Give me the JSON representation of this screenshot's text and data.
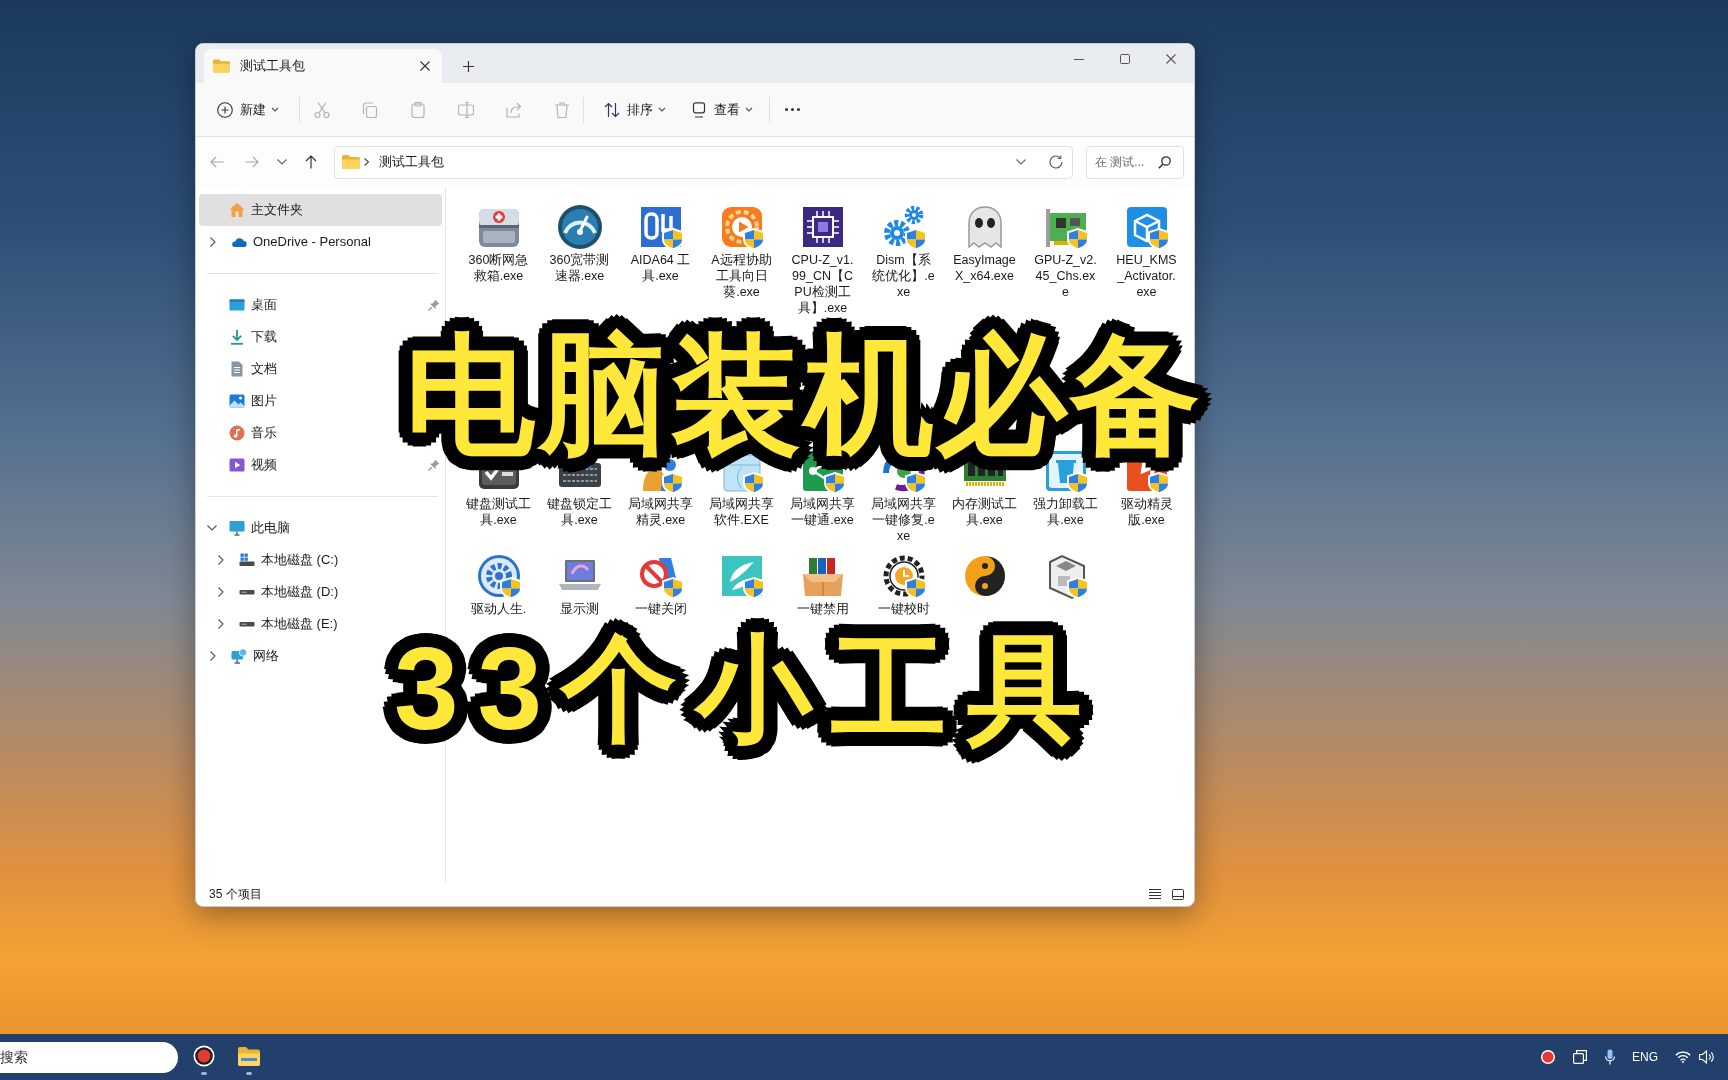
{
  "tabs": [
    {
      "title": "测试工具包",
      "selected": true
    }
  ],
  "toolbar": {
    "new_button": {
      "label": "新建"
    },
    "actions": [
      {
        "disabled": true
      },
      {
        "disabled": true
      },
      {
        "disabled": true
      },
      {
        "disabled": true
      },
      {
        "disabled": true
      },
      {
        "disabled": true
      }
    ],
    "sort_button": {
      "label": "排序"
    },
    "view_button": {
      "label": "查看"
    }
  },
  "navigation": {
    "back": {
      "disabled": true
    },
    "forward": {
      "disabled": true
    },
    "up": {
      "disabled": false
    }
  },
  "address_bar": {
    "path": [
      "测试工具包"
    ]
  },
  "search": {
    "placeholder": "在 测试..."
  },
  "sidebar": {
    "sections": [
      {
        "items": [
          {
            "label": "主文件夹",
            "selected": true
          },
          {
            "label": "OneDrive - Personal",
            "selected": false,
            "expanded": false
          }
        ]
      },
      {
        "items": [
          {
            "label": "桌面",
            "selected": false,
            "pinned": true
          },
          {
            "label": "下载",
            "selected": false,
            "pinned": false
          },
          {
            "label": "文档",
            "selected": false,
            "pinned": false
          },
          {
            "label": "图片",
            "selected": false,
            "pinned": false
          },
          {
            "label": "音乐",
            "selected": false,
            "pinned": false
          },
          {
            "label": "视频",
            "selected": false,
            "pinned": true
          }
        ]
      },
      {
        "items": [
          {
            "label": "此电脑",
            "selected": false,
            "expanded": true,
            "children": [
              {
                "label": "本地磁盘 (C:)",
                "selected": false,
                "expanded": false
              },
              {
                "label": "本地磁盘 (D:)",
                "selected": false,
                "expanded": false
              },
              {
                "label": "本地磁盘 (E:)",
                "selected": false,
                "expanded": false
              }
            ]
          },
          {
            "label": "网络",
            "selected": false,
            "expanded": false
          }
        ]
      }
    ]
  },
  "files": {
    "rows": [
      [
        {
          "label": "360断网急救箱.exe",
          "admin_shield": false
        },
        {
          "label": "360宽带测速器.exe",
          "admin_shield": false
        },
        {
          "label": "AIDA64 工具.exe",
          "admin_shield": true
        },
        {
          "label": "A远程协助工具向日葵.exe",
          "admin_shield": true
        },
        {
          "label": "CPU-Z_v1.99_CN【CPU检测工具】.exe",
          "admin_shield": false
        },
        {
          "label": "Dism【系统优化】.exe",
          "admin_shield": true
        },
        {
          "label": "EasyImageX_x64.exe",
          "admin_shield": false
        },
        {
          "label": "GPU-Z_v2.45_Chs.exe",
          "admin_shield": true
        },
        {
          "label": "HEU_KMS_Activator.exe",
          "admin_shield": true
        }
      ],
      [
        {
          "label": "键盘测试工具.exe",
          "admin_shield": false
        },
        {
          "label": "键盘锁定工具.exe",
          "admin_shield": false
        },
        {
          "label": "局域网共享精灵.exe",
          "admin_shield": true
        },
        {
          "label": "局域网共享软件.EXE",
          "admin_shield": true
        },
        {
          "label": "局域网共享一键通.exe",
          "admin_shield": true
        },
        {
          "label": "局域网共享一键修复.exe",
          "admin_shield": true
        },
        {
          "label": "内存测试工具.exe",
          "admin_shield": false
        },
        {
          "label": "强力卸载工具.exe",
          "admin_shield": true
        },
        {
          "label": "驱动精灵版.exe",
          "admin_shield": true
        }
      ],
      [
        {
          "label": "驱动人生.",
          "admin_shield": true
        },
        {
          "label": "显示测",
          "admin_shield": false
        },
        {
          "label": "一键关闭",
          "admin_shield": true
        },
        {
          "admin_shield": true
        },
        {
          "label": "一键禁用",
          "admin_shield": false
        },
        {
          "label": "一键校时",
          "admin_shield": true
        },
        {
          "admin_shield": false
        },
        {
          "admin_shield": true
        }
      ]
    ]
  },
  "status_bar": {
    "item_count": "35 个项目"
  },
  "overlay_caption": {
    "lines": [
      "电脑装机必备",
      "33个小工具"
    ]
  },
  "taskbar": {
    "search": {
      "placeholder": "搜索"
    },
    "language": "ENG"
  }
}
